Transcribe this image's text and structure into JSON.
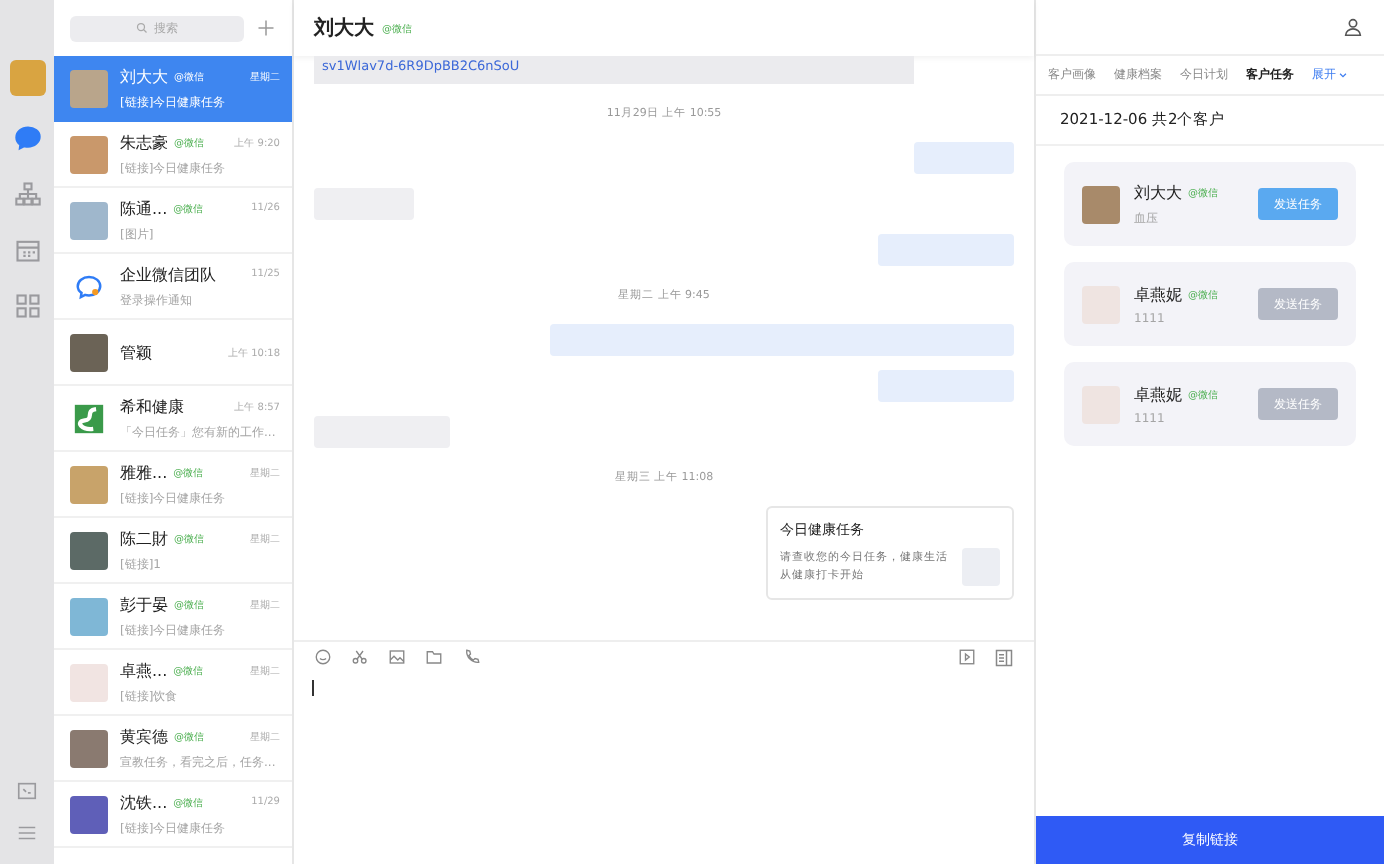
{
  "rail": {
    "items": [
      {
        "kind": "chat",
        "selected": true
      },
      {
        "kind": "org",
        "selected": false
      },
      {
        "kind": "calendar",
        "selected": false
      },
      {
        "kind": "apps",
        "selected": false
      }
    ]
  },
  "conversation_list": {
    "search": {
      "placeholder": "搜索"
    },
    "items": [
      {
        "kind": "photo",
        "name": "刘大大",
        "tag": "@微信",
        "time": "星期二",
        "preview": "[链接]今日健康任务",
        "selected": true
      },
      {
        "kind": "photo",
        "name": "朱志豪",
        "tag": "@微信",
        "time": "上午 9:20",
        "preview": "[链接]今日健康任务",
        "selected": false
      },
      {
        "kind": "photo",
        "name": "陈通...",
        "tag": "@微信",
        "time": "11/26",
        "preview": "[图片]",
        "selected": false
      },
      {
        "kind": "logo",
        "name": "企业微信团队",
        "time": "11/25",
        "preview": "登录操作通知",
        "selected": false
      },
      {
        "kind": "photo",
        "name": "管颖",
        "time": "上午 10:18",
        "selected": false
      },
      {
        "kind": "brand",
        "name": "希和健康",
        "time": "上午 8:57",
        "preview": "「今日任务」您有新的工作...",
        "selected": false
      },
      {
        "kind": "photo",
        "name": "雅雅...",
        "tag": "@微信",
        "time": "星期二",
        "preview": "[链接]今日健康任务",
        "selected": false
      },
      {
        "kind": "photo",
        "name": "陈二財",
        "tag": "@微信",
        "time": "星期二",
        "preview": "[链接]1",
        "selected": false
      },
      {
        "kind": "photo",
        "name": "彭于晏",
        "tag": "@微信",
        "time": "星期二",
        "preview": "[链接]今日健康任务",
        "selected": false
      },
      {
        "kind": "photo",
        "name": "卓燕...",
        "tag": "@微信",
        "time": "星期二",
        "preview": "[链接]饮食",
        "selected": false
      },
      {
        "kind": "photo",
        "name": "黄宾德",
        "tag": "@微信",
        "time": "星期二",
        "preview": "宣教任务，看完之后，任务...",
        "selected": false
      },
      {
        "kind": "photo",
        "name": "沈铁...",
        "tag": "@微信",
        "time": "11/29",
        "preview": "[链接]今日健康任务",
        "selected": false
      }
    ]
  },
  "chat": {
    "title": "刘大大",
    "tag": "@微信",
    "messages": [
      {
        "kind": "link",
        "text": "sv1Wlav7d-6R9DpBB2C6nSoU"
      },
      {
        "kind": "time",
        "text": "11月29日 上午 10:55"
      },
      {
        "kind": "sent"
      },
      {
        "kind": "received"
      },
      {
        "kind": "sent"
      },
      {
        "kind": "time",
        "text": "星期二 上午 9:45"
      },
      {
        "kind": "sent"
      },
      {
        "kind": "sent"
      },
      {
        "kind": "received"
      },
      {
        "kind": "time",
        "text": "星期三 上午 11:08"
      },
      {
        "kind": "card",
        "title": "今日健康任务",
        "text": "请查收您的今日任务，健康生活从健康打卡开始"
      }
    ]
  },
  "customer_panel": {
    "tabs": [
      {
        "label": "客户画像",
        "selected": false
      },
      {
        "label": "健康档案",
        "selected": false
      },
      {
        "label": "今日计划",
        "selected": false
      },
      {
        "label": "客户任务",
        "selected": true
      }
    ],
    "expand": "展开",
    "summary": "2021-12-06  共2个客户",
    "customers": [
      {
        "name": "刘大大",
        "tag": "@微信",
        "note": "血压",
        "button": "发送任务",
        "disabled": false
      },
      {
        "name": "卓燕妮",
        "tag": "@微信",
        "note": "1111",
        "button": "发送任务",
        "disabled": true
      },
      {
        "name": "卓燕妮",
        "tag": "@微信",
        "note": "1111",
        "button": "发送任务",
        "disabled": true
      }
    ],
    "copy_button": "复制链接"
  }
}
